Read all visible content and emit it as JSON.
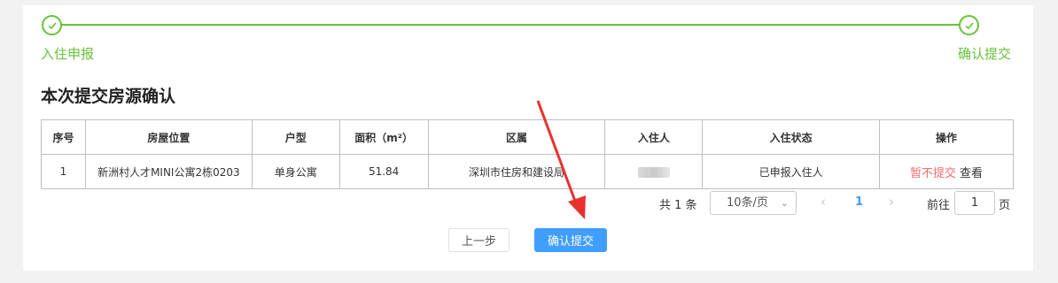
{
  "steps": [
    {
      "label": "入住申报"
    },
    {
      "label": "确认提交"
    }
  ],
  "section_title": "本次提交房源确认",
  "table": {
    "headers": [
      "序号",
      "房屋位置",
      "户型",
      "面积（m²）",
      "区属",
      "入住人",
      "入住状态",
      "操作"
    ],
    "rows": [
      {
        "index": "1",
        "location": "新洲村人才MINI公寓2栋0203",
        "type": "单身公寓",
        "area": "51.84",
        "district": "深圳市住房和建设局",
        "status": "已申报入住人",
        "action_cancel": "暂不提交",
        "action_view": "查看"
      }
    ]
  },
  "pagination": {
    "total_text": "共 1 条",
    "page_size": "10条/页",
    "current_page": "1",
    "goto_prefix": "前往",
    "goto_value": "1",
    "goto_suffix": "页",
    "prev_icon": "chevron-left-icon",
    "next_icon": "chevron-right-icon"
  },
  "buttons": {
    "prev": "上一步",
    "confirm": "确认提交"
  },
  "colors": {
    "step_green": "#67c23a",
    "primary": "#409eff",
    "danger": "#f56c6c",
    "annotation_arrow": "#e8322d"
  }
}
